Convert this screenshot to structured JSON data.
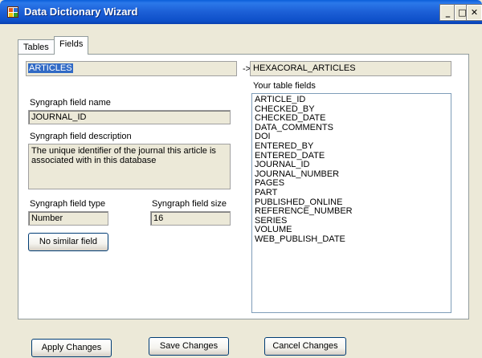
{
  "window": {
    "title": "Data Dictionary Wizard",
    "min_glyph": "_",
    "max_glyph": "□",
    "close_glyph": "✕"
  },
  "tabs": [
    {
      "label": "Tables",
      "active": false
    },
    {
      "label": "Fields",
      "active": true
    }
  ],
  "fields_panel": {
    "source_table": "ARTICLES",
    "arrow": "->",
    "target_table": "HEXACORAL_ARTICLES",
    "your_fields_label": "Your table fields",
    "your_fields": [
      "ARTICLE_ID",
      "CHECKED_BY",
      "CHECKED_DATE",
      "DATA_COMMENTS",
      "DOI",
      "ENTERED_BY",
      "ENTERED_DATE",
      "JOURNAL_ID",
      "JOURNAL_NUMBER",
      "PAGES",
      "PART",
      "PUBLISHED_ONLINE",
      "REFERENCE_NUMBER",
      "SERIES",
      "VOLUME",
      "WEB_PUBLISH_DATE"
    ],
    "field_name_label": "Syngraph field name",
    "field_name_value": "JOURNAL_ID",
    "field_desc_label": "Syngraph field description",
    "field_desc_value": "The unique identifier of the journal this article is associated with in this database",
    "field_type_label": "Syngraph field type",
    "field_type_value": "Number",
    "field_size_label": "Syngraph field size",
    "field_size_value": "16",
    "no_similar_button": "No similar field"
  },
  "footer": {
    "apply_label": "Apply Changes",
    "save_label": "Save Changes",
    "cancel_label": "Cancel Changes"
  }
}
